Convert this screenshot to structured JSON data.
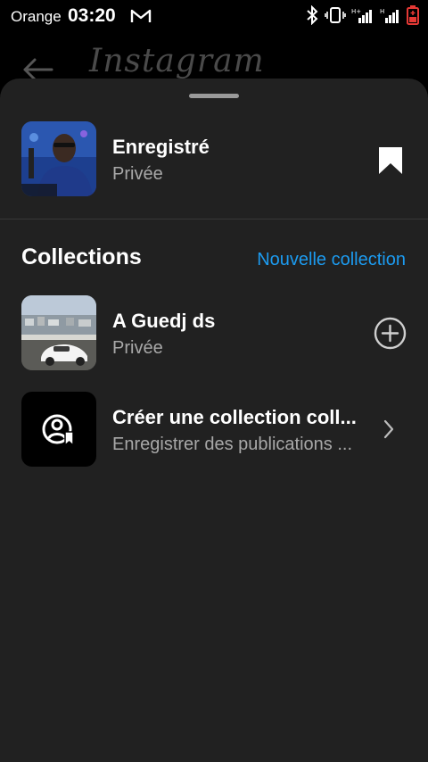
{
  "status_bar": {
    "carrier": "Orange",
    "time": "03:20",
    "icons": [
      "gmail-icon",
      "bluetooth-icon",
      "vibrate-icon",
      "signal-icon",
      "signal-icon",
      "battery-icon"
    ]
  },
  "background_header": {
    "title": "Instagram"
  },
  "saved": {
    "title": "Enregistré",
    "privacy": "Privée"
  },
  "collections": {
    "heading": "Collections",
    "new_label": "Nouvelle collection",
    "items": [
      {
        "title": "A Guedj ds",
        "subtitle": "Privée"
      },
      {
        "title": "Créer une collection coll...",
        "subtitle": "Enregistrer des publications ..."
      }
    ]
  },
  "colors": {
    "sheet_bg": "#212121",
    "accent": "#1c9bf0",
    "secondary_text": "#a8a8a8"
  }
}
